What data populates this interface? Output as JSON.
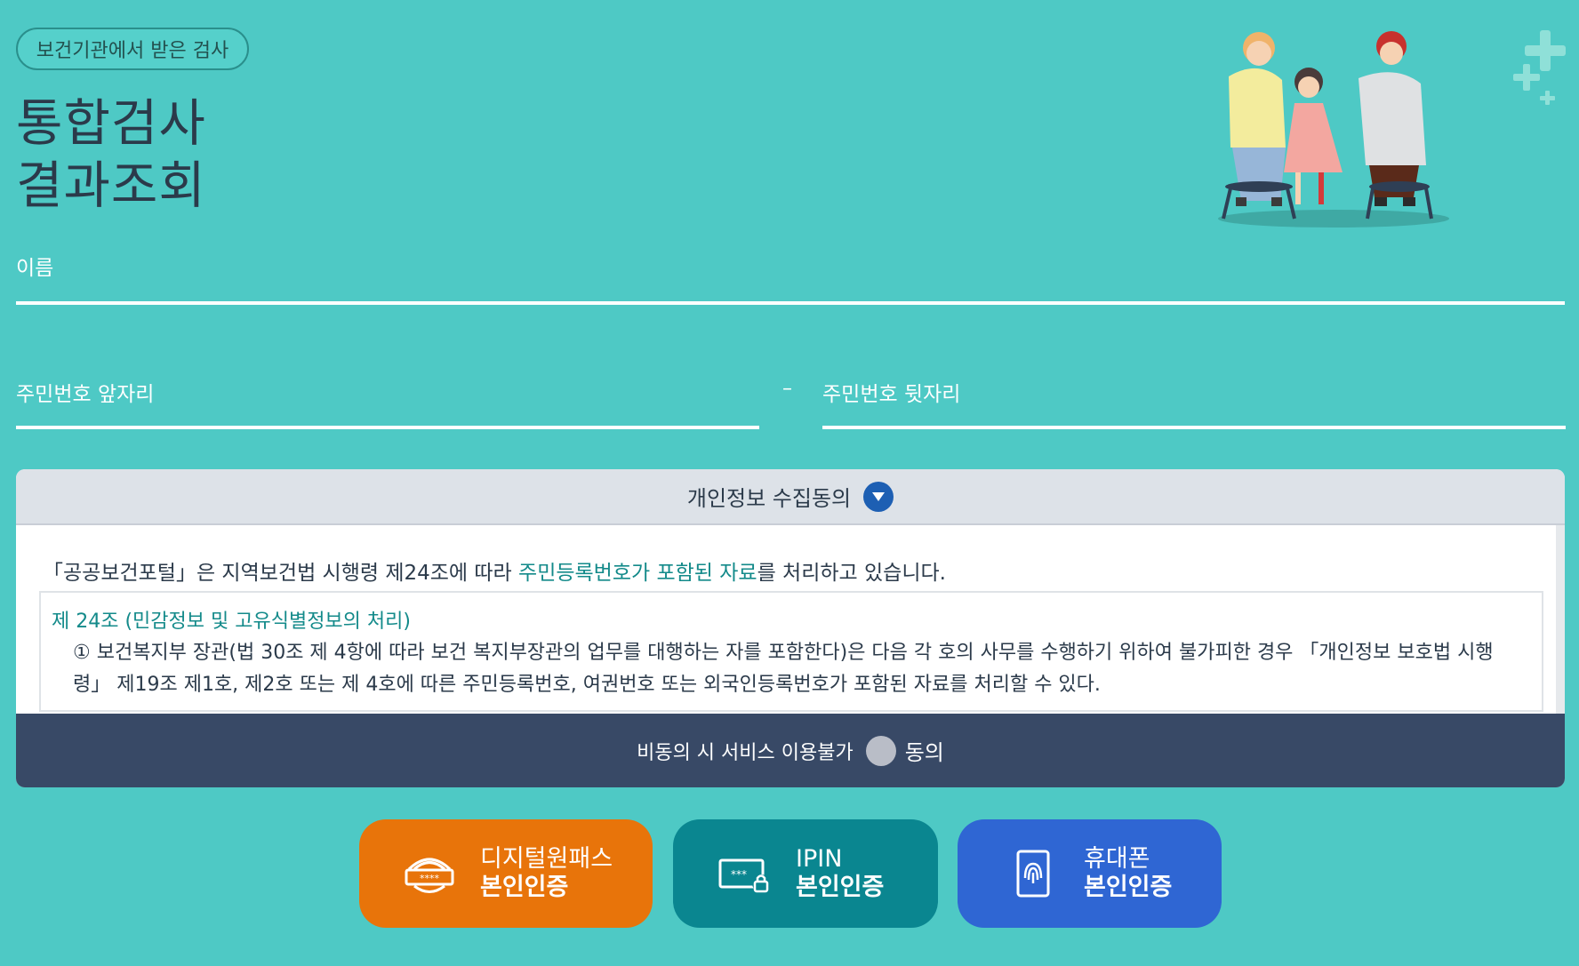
{
  "header": {
    "badge": "보건기관에서 받은 검사",
    "title_line1": "통합검사",
    "title_line2": "결과조회"
  },
  "form": {
    "name_placeholder": "이름",
    "rrn_front_placeholder": "주민번호 앞자리",
    "separator": "–",
    "rrn_back_placeholder": "주민번호 뒷자리"
  },
  "consent": {
    "header": "개인정보 수집동의",
    "intro_before": "「공공보건포털」은 지역보건법 시행령 제24조에 따라 ",
    "intro_highlight": "주민등록번호가 포함된 자료",
    "intro_after": "를 처리하고 있습니다.",
    "article_title": "제 24조 (민감정보 및 고유식별정보의 처리)",
    "article_text": "① 보건복지부 장관(법 30조 제 4항에 따라 보건 복지부장관의 업무를 대행하는 자를 포함한다)은 다음 각 호의 사무를 수행하기 위하여 불가피한 경우 「개인정보 보호법 시행령」 제19조 제1호, 제2호 또는 제 4호에 따른 주민등록번호, 여권번호 또는 외국인등록번호가 포함된 자료를 처리할 수 있다.",
    "footer_notice": "비동의 시 서비스 이용불가",
    "agree_label": "동의"
  },
  "auth_buttons": [
    {
      "line1": "디지털원패스",
      "line2": "본인인증",
      "icon": "digital-onepass-icon",
      "color": "#e8740a"
    },
    {
      "line1": "IPIN",
      "line2": "본인인증",
      "icon": "ipin-icon",
      "color": "#0a8690"
    },
    {
      "line1": "휴대폰",
      "line2": "본인인증",
      "icon": "phone-icon",
      "color": "#2f66d3"
    }
  ]
}
